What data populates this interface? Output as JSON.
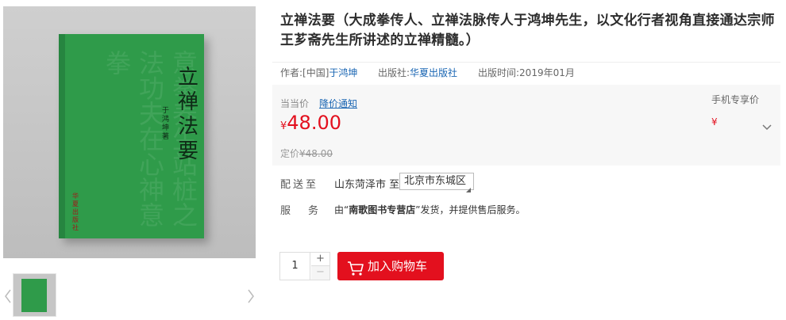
{
  "gallery": {
    "book_title": "立禅法要",
    "book_author": "于鸿坤著",
    "book_publisher": "华夏出版社",
    "calligraphy": "意拳养生站桩之法功夫在心神意拳"
  },
  "product": {
    "title": "立禅法要（大成拳传人、立禅法脉传人于鸿坤先生，以文化行者视角直接通达宗师王芗斋先生所讲述的立禅精髓。）",
    "author_label": "作者:",
    "author_prefix": "[中国]",
    "author_name": "于鸿坤",
    "publisher_label": "出版社:",
    "publisher_name": "华夏出版社",
    "pubdate_label": "出版时间:",
    "pubdate": "2019年01月"
  },
  "price": {
    "label": "当当价",
    "notice": "降价通知",
    "currency": "¥",
    "value": "48.00",
    "original_label": "定价",
    "original_value": "¥48.00",
    "mobile_label": "手机专享价",
    "mobile_currency": "¥"
  },
  "delivery": {
    "label": "配送至",
    "from": "山东菏泽市 至",
    "destination": "北京市东城区"
  },
  "service": {
    "label_a": "服",
    "label_b": "务",
    "prefix": "由“",
    "store": "南歌图书专营店",
    "suffix": "”发货，并提供售后服务。"
  },
  "purchase": {
    "quantity": "1",
    "plus": "+",
    "minus": "−",
    "cart_label": "加入购物车"
  },
  "colors": {
    "accent_red": "#e3101e",
    "link_blue": "#1a66b3",
    "book_green": "#2f9b4a"
  }
}
